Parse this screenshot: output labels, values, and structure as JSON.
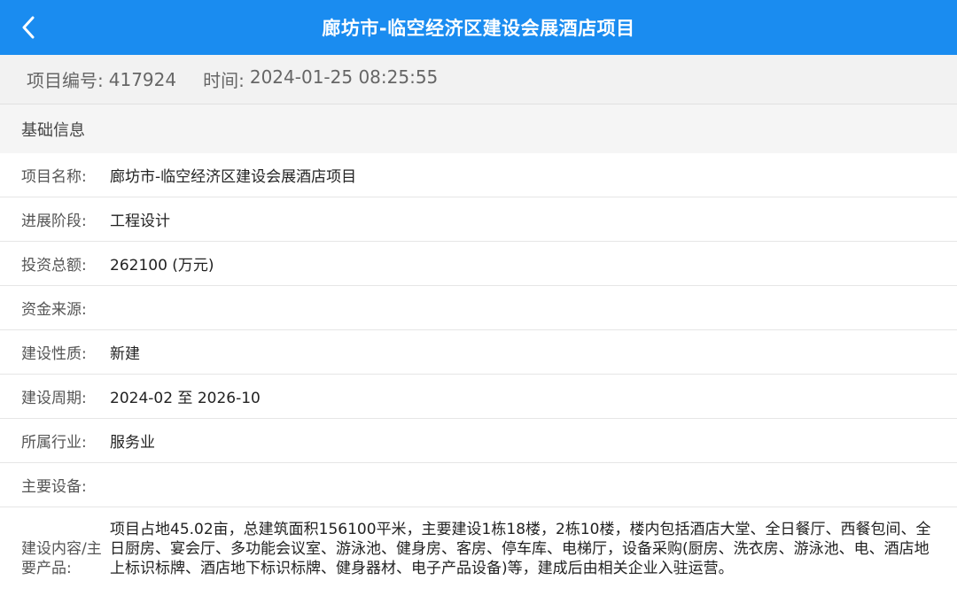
{
  "header": {
    "title": "廊坊市-临空经济区建设会展酒店项目",
    "back_icon": "chevron-left-icon"
  },
  "meta": {
    "project_no_label": "项目编号:",
    "project_no": "417924",
    "time_label": "时间:",
    "time_value": "2024-01-25 08:25:55"
  },
  "section": {
    "title": "基础信息"
  },
  "fields": [
    {
      "label": "项目名称:",
      "value": "廊坊市-临空经济区建设会展酒店项目"
    },
    {
      "label": "进展阶段:",
      "value": "工程设计"
    },
    {
      "label": "投资总额:",
      "value": "262100 (万元)"
    },
    {
      "label": "资金来源:",
      "value": ""
    },
    {
      "label": "建设性质:",
      "value": "新建"
    },
    {
      "label": "建设周期:",
      "value": "2024-02 至 2026-10"
    },
    {
      "label": "所属行业:",
      "value": "服务业"
    },
    {
      "label": "主要设备:",
      "value": ""
    },
    {
      "label": "建设内容/主要产品:",
      "value": "项目占地45.02亩，总建筑面积156100平米，主要建设1栋18楼，2栋10楼，楼内包括酒店大堂、全日餐厅、西餐包间、全日厨房、宴会厅、多功能会议室、游泳池、健身房、客房、停车库、电梯厅，设备采购(厨房、洗衣房、游泳池、电、酒店地上标识标牌、酒店地下标识标牌、健身器材、电子产品设备)等，建成后由相关企业入驻运营。"
    }
  ],
  "colors": {
    "header_bg": "#1a8cf0",
    "meta_bg": "#f2f2f2"
  }
}
